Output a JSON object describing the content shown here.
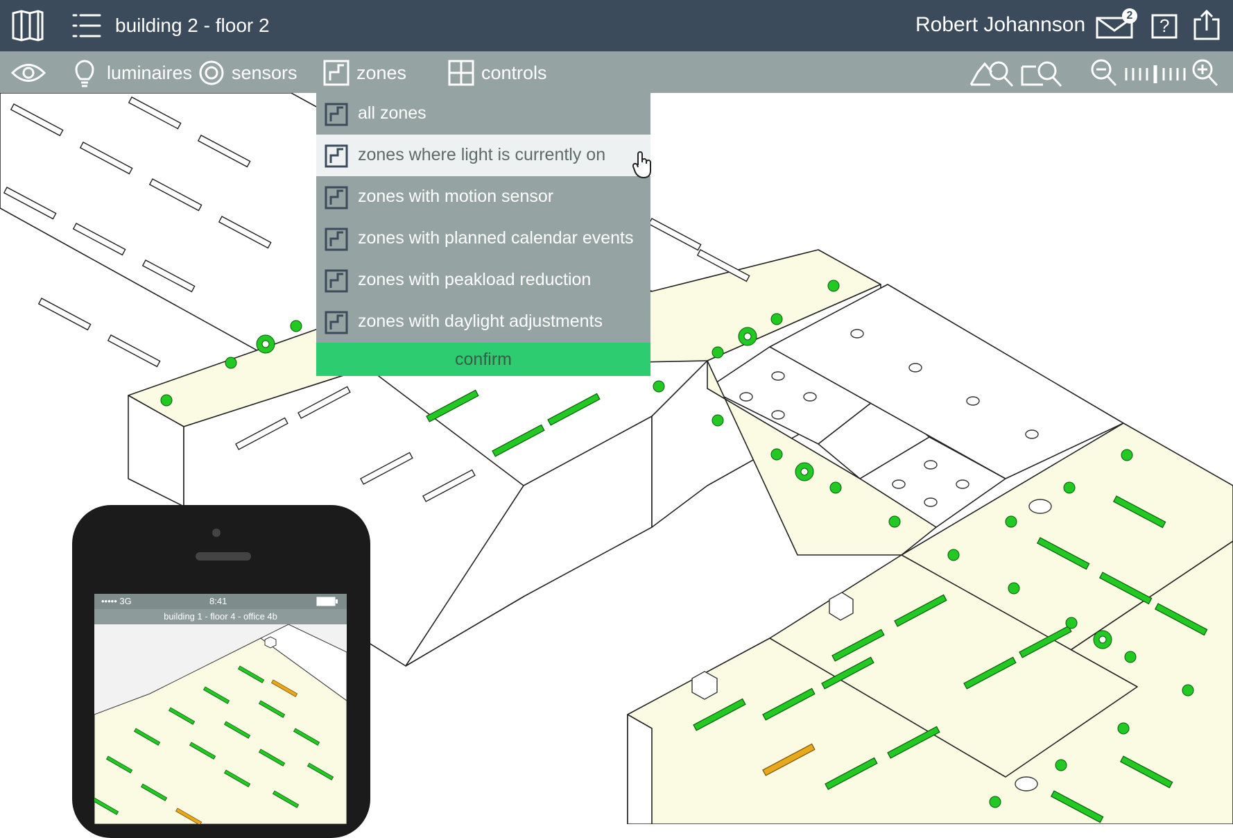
{
  "header": {
    "location": "building 2 - floor 2",
    "user": "Robert Johannson",
    "mail_count": "2",
    "help_label": "?"
  },
  "toolbar": {
    "luminaires": "luminaires",
    "sensors": "sensors",
    "zones": "zones",
    "controls": "controls"
  },
  "dropdown": {
    "items": [
      {
        "label": "all zones"
      },
      {
        "label": "zones where light is currently on"
      },
      {
        "label": "zones with motion sensor"
      },
      {
        "label": "zones with planned calendar events"
      },
      {
        "label": "zones with peakload reduction"
      },
      {
        "label": "zones with daylight adjustments"
      }
    ],
    "hovered_index": 1,
    "confirm_label": "confirm"
  },
  "phone": {
    "signal": "••••• 3G",
    "time": "8:41",
    "title": "building 1 - floor 4 - office 4b"
  },
  "colors": {
    "header_bg": "#3b4b5b",
    "toolbar_bg": "#95a3a2",
    "zone_fill": "#fbfbe3",
    "light_on": "#22c922",
    "light_warn": "#e8a81c",
    "confirm_bg": "#2ecc71"
  }
}
